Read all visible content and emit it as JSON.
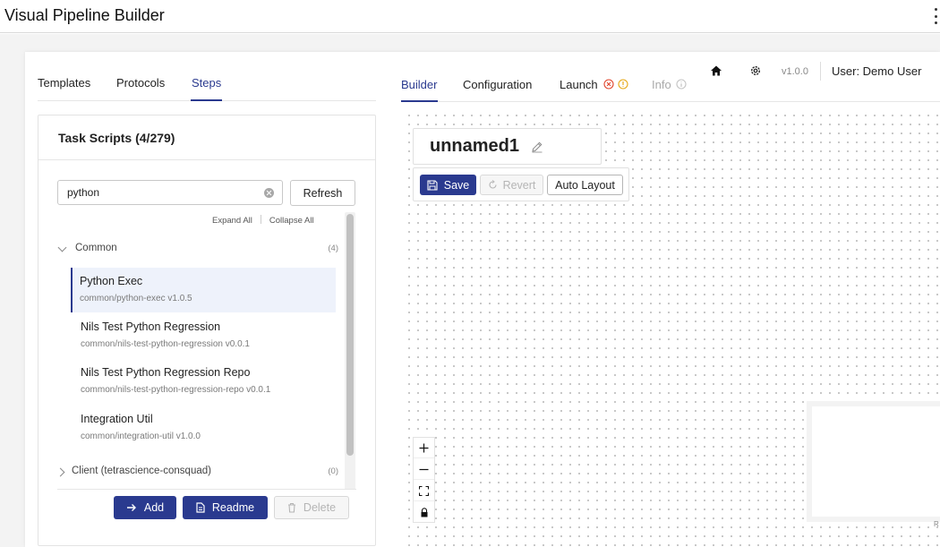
{
  "app": {
    "title": "Visual Pipeline Builder"
  },
  "left_tabs": [
    "Templates",
    "Protocols",
    "Steps"
  ],
  "left_active_tab": "Steps",
  "task_panel": {
    "title": "Task Scripts (4/279)",
    "search": {
      "value": "python",
      "placeholder": ""
    },
    "refresh_label": "Refresh",
    "expand_all": "Expand All",
    "collapse_all": "Collapse All",
    "groups": [
      {
        "label": "Common",
        "count": "(4)",
        "expanded": true,
        "items": [
          {
            "name": "Python Exec",
            "path": "common/python-exec v1.0.5",
            "selected": true
          },
          {
            "name": "Nils Test Python Regression",
            "path": "common/nils-test-python-regression v0.0.1"
          },
          {
            "name": "Nils Test Python Regression Repo",
            "path": "common/nils-test-python-regression-repo v0.0.1"
          },
          {
            "name": "Integration Util",
            "path": "common/integration-util v1.0.0"
          }
        ]
      },
      {
        "label": "Client (tetrascience-consquad)",
        "count": "(0)",
        "expanded": false
      }
    ],
    "buttons": {
      "add": "Add",
      "readme": "Readme",
      "delete": "Delete"
    }
  },
  "right_tabs": {
    "builder": "Builder",
    "configuration": "Configuration",
    "launch": "Launch",
    "info": "Info"
  },
  "topbar": {
    "version": "v1.0.0",
    "user": "User: Demo User"
  },
  "pipeline": {
    "name": "unnamed1"
  },
  "toolbar": {
    "save": "Save",
    "revert": "Revert",
    "auto_layout": "Auto Layout"
  },
  "minimap": {
    "corner_text": "R"
  },
  "colors": {
    "primary": "#2a3a8f",
    "error": "#e0452d",
    "warning": "#e6a817"
  }
}
